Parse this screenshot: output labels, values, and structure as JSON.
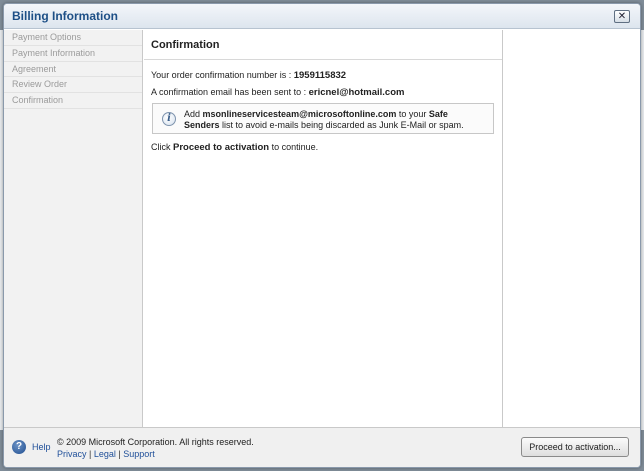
{
  "dialog": {
    "title": "Billing Information",
    "close_icon": "close-icon"
  },
  "sidebar": {
    "items": [
      {
        "label": "Payment Options"
      },
      {
        "label": "Payment Information"
      },
      {
        "label": "Agreement"
      },
      {
        "label": "Review Order"
      },
      {
        "label": "Confirmation"
      }
    ]
  },
  "main": {
    "heading": "Confirmation",
    "order_prefix": "Your order confirmation number is : ",
    "order_number": "1959115832",
    "email_prefix": "A confirmation email has been sent to : ",
    "email_address": "ericnel@hotmail.com",
    "info": {
      "icon": "info-icon",
      "add_label": "Add ",
      "sender": "msonlineservicesteam@microsoftonline.com",
      "to_your": " to your ",
      "safe_senders": "Safe Senders",
      "suffix": " list to avoid e-mails being discarded as Junk E-Mail or spam."
    },
    "instruction_prefix": "Click ",
    "instruction_action": "Proceed to activation",
    "instruction_suffix": " to continue."
  },
  "footer": {
    "help_icon": "help-icon",
    "help_label": "Help",
    "copyright": "© 2009 Microsoft Corporation. All rights reserved.",
    "links": [
      "Privacy",
      "Legal",
      "Support"
    ],
    "proceed_button": "Proceed to activation..."
  }
}
